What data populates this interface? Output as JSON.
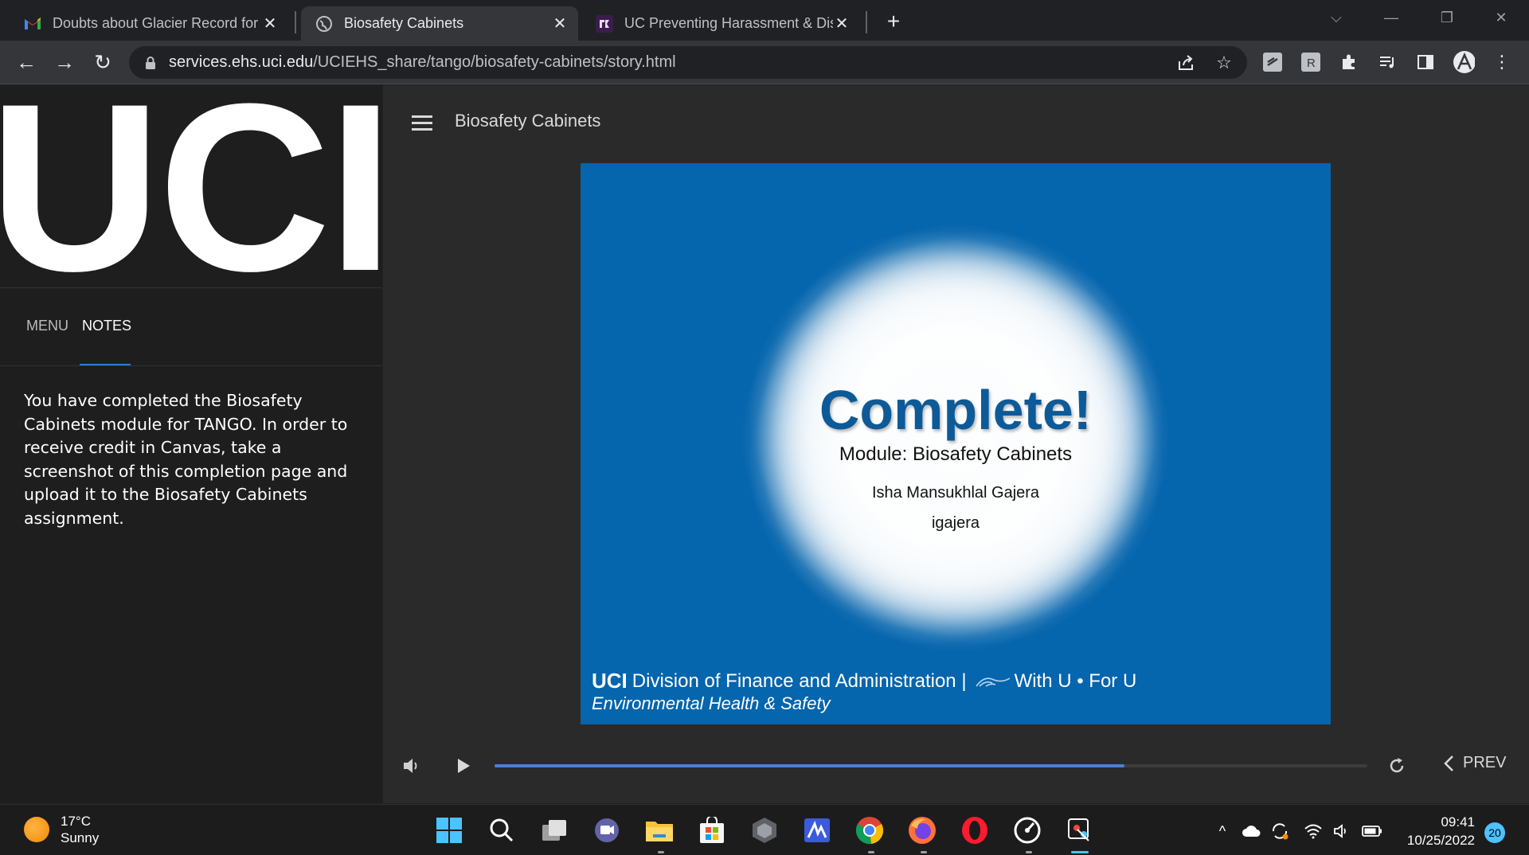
{
  "browser": {
    "tabs": [
      {
        "title": "Doubts about Glacier Record for",
        "icon": "gmail-icon",
        "active": false
      },
      {
        "title": "Biosafety Cabinets",
        "icon": "globe-icon",
        "active": true
      },
      {
        "title": "UC Preventing Harassment & Dis",
        "icon": "course-icon",
        "active": false
      }
    ],
    "new_tab_symbol": "+",
    "url_host": "services.ehs.uci.edu",
    "url_path": "/UCIEHS_share/tango/biosafety-cabinets/story.html"
  },
  "sidebar": {
    "logo_text": "UCI",
    "tabs": [
      {
        "label": "MENU",
        "active": false
      },
      {
        "label": "NOTES",
        "active": true
      }
    ],
    "notes_text": "You have completed the Biosafety Cabinets module for TANGO. In order to receive credit in Canvas, take a screenshot of this completion page and upload it to the Biosafety Cabinets assignment."
  },
  "player": {
    "course_title": "Biosafety Cabinets",
    "slide": {
      "heading": "Complete!",
      "module": "Module: Biosafety Cabinets",
      "learner_name": "Isha Mansukhlal Gajera",
      "learner_id": "igajera",
      "footer_brand": "UCI",
      "footer_division": "Division of Finance and Administration |",
      "footer_tagline": "With U • For U",
      "footer_department": "Environmental Health & Safety"
    },
    "progress_fraction": 0.722,
    "prev_label": "PREV"
  },
  "taskbar": {
    "weather_temp": "17°C",
    "weather_condition": "Sunny",
    "time": "09:41",
    "date": "10/25/2022",
    "notification_count": "20"
  },
  "colors": {
    "slide_background": "#0565ad",
    "heading": "#0d5a99",
    "progress": "#4c7fd0",
    "accent_underline": "#2b7bd1"
  }
}
